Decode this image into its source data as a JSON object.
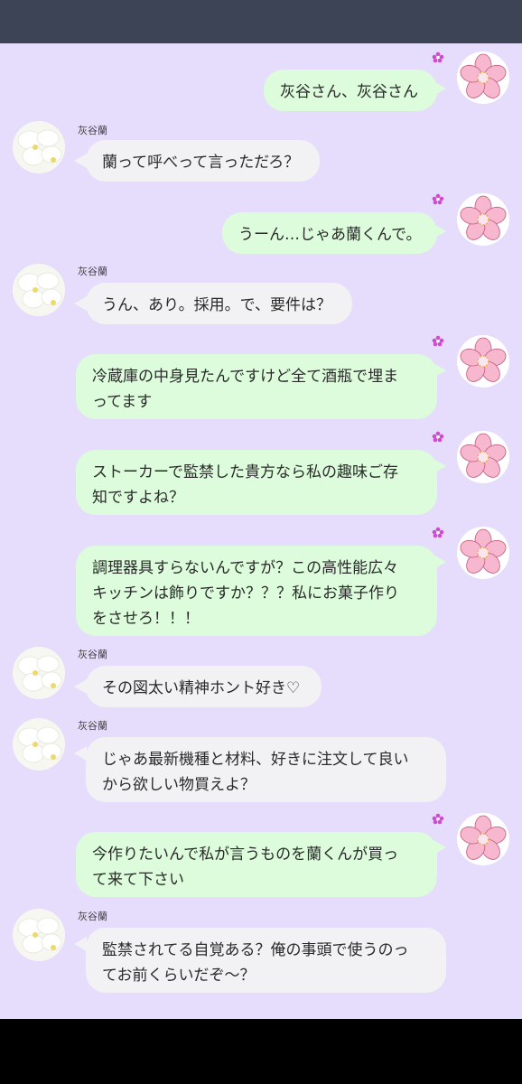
{
  "chat": {
    "contact_name": "灰谷蘭",
    "messages": [
      {
        "side": "out",
        "lines": [
          "灰谷さん、灰谷さん"
        ]
      },
      {
        "side": "in",
        "name": "灰谷蘭",
        "lines": [
          "蘭って呼べって言っただろ？"
        ]
      },
      {
        "side": "out",
        "lines": [
          "うーん…じゃあ蘭くんで。"
        ]
      },
      {
        "side": "in",
        "name": "灰谷蘭",
        "lines": [
          "うん、あり。採用。で、要件は？"
        ]
      },
      {
        "side": "out",
        "lines": [
          "冷蔵庫の中身見たんですけど全て酒瓶で埋ま",
          "ってます"
        ]
      },
      {
        "side": "out",
        "lines": [
          "ストーカーで監禁した貴方なら私の趣味ご存",
          "知ですよね？"
        ]
      },
      {
        "side": "out",
        "lines": [
          "調理器具すらないんですが？この高性能広々",
          "キッチンは飾りですか？？？私にお菓子作り",
          "をさせろ！！！"
        ]
      },
      {
        "side": "in",
        "name": "灰谷蘭",
        "lines": [
          "その図太い精神ホント好き♡"
        ]
      },
      {
        "side": "in",
        "name": "灰谷蘭",
        "lines": [
          "じゃあ最新機種と材料、好きに注文して良い",
          "から欲しい物買えよ？"
        ]
      },
      {
        "side": "out",
        "lines": [
          "今作りたいんで私が言うものを蘭くんが買っ",
          "て来て下さい"
        ]
      },
      {
        "side": "in",
        "name": "灰谷蘭",
        "lines": [
          "監禁されてる自覚ある？俺の事頭で使うのっ",
          "てお前くらいだぞ〜？"
        ]
      }
    ]
  }
}
